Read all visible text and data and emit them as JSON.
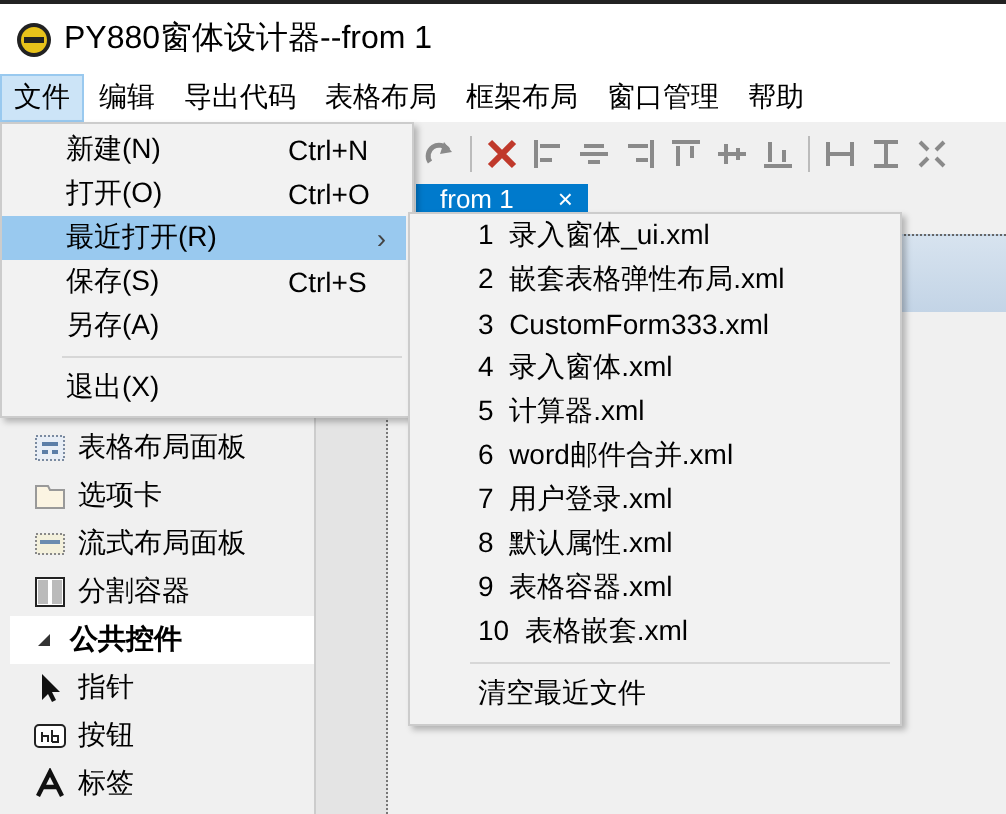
{
  "window": {
    "title": "PY880窗体设计器--from 1"
  },
  "menu_bar": [
    {
      "label": "文件",
      "selected": true
    },
    {
      "label": "编辑",
      "selected": false
    },
    {
      "label": "导出代码",
      "selected": false
    },
    {
      "label": "表格布局",
      "selected": false
    },
    {
      "label": "框架布局",
      "selected": false
    },
    {
      "label": "窗口管理",
      "selected": false
    },
    {
      "label": "帮助",
      "selected": false
    }
  ],
  "file_menu": [
    {
      "kind": "item",
      "label": "新建(N)",
      "shortcut": "Ctrl+N",
      "selected": false
    },
    {
      "kind": "item",
      "label": "打开(O)",
      "shortcut": "Ctrl+O",
      "selected": false
    },
    {
      "kind": "submenu",
      "label": "最近打开(R)",
      "arrow": "›",
      "selected": true
    },
    {
      "kind": "item",
      "label": "保存(S)",
      "shortcut": "Ctrl+S",
      "selected": false
    },
    {
      "kind": "item",
      "label": "另存(A)",
      "selected": false
    },
    {
      "kind": "separator"
    },
    {
      "kind": "item",
      "label": "退出(X)",
      "selected": false
    }
  ],
  "recent_menu": [
    {
      "kind": "item",
      "label": "1  录入窗体_ui.xml"
    },
    {
      "kind": "item",
      "label": "2  嵌套表格弹性布局.xml"
    },
    {
      "kind": "item",
      "label": "3  CustomForm333.xml"
    },
    {
      "kind": "item",
      "label": "4  录入窗体.xml"
    },
    {
      "kind": "item",
      "label": "5  计算器.xml"
    },
    {
      "kind": "item",
      "label": "6  word邮件合并.xml"
    },
    {
      "kind": "item",
      "label": "7  用户登录.xml"
    },
    {
      "kind": "item",
      "label": "8  默认属性.xml"
    },
    {
      "kind": "item",
      "label": "9  表格容器.xml"
    },
    {
      "kind": "item",
      "label": "10  表格嵌套.xml"
    },
    {
      "kind": "separator"
    },
    {
      "kind": "item",
      "label": "清空最近文件"
    }
  ],
  "document_tabs": [
    {
      "label": "from 1",
      "close": "×",
      "selected": true
    }
  ],
  "toolbox": [
    {
      "kind": "table-panel",
      "label": "表格布局面板"
    },
    {
      "kind": "tab",
      "label": "选项卡"
    },
    {
      "kind": "flow-panel",
      "label": "流式布局面板"
    },
    {
      "kind": "split",
      "label": "分割容器"
    },
    {
      "kind": "group",
      "label": "公共控件",
      "expanded": true
    },
    {
      "kind": "pointer",
      "label": "指针"
    },
    {
      "kind": "button",
      "label": "按钮"
    },
    {
      "kind": "label",
      "label": "标签"
    }
  ]
}
